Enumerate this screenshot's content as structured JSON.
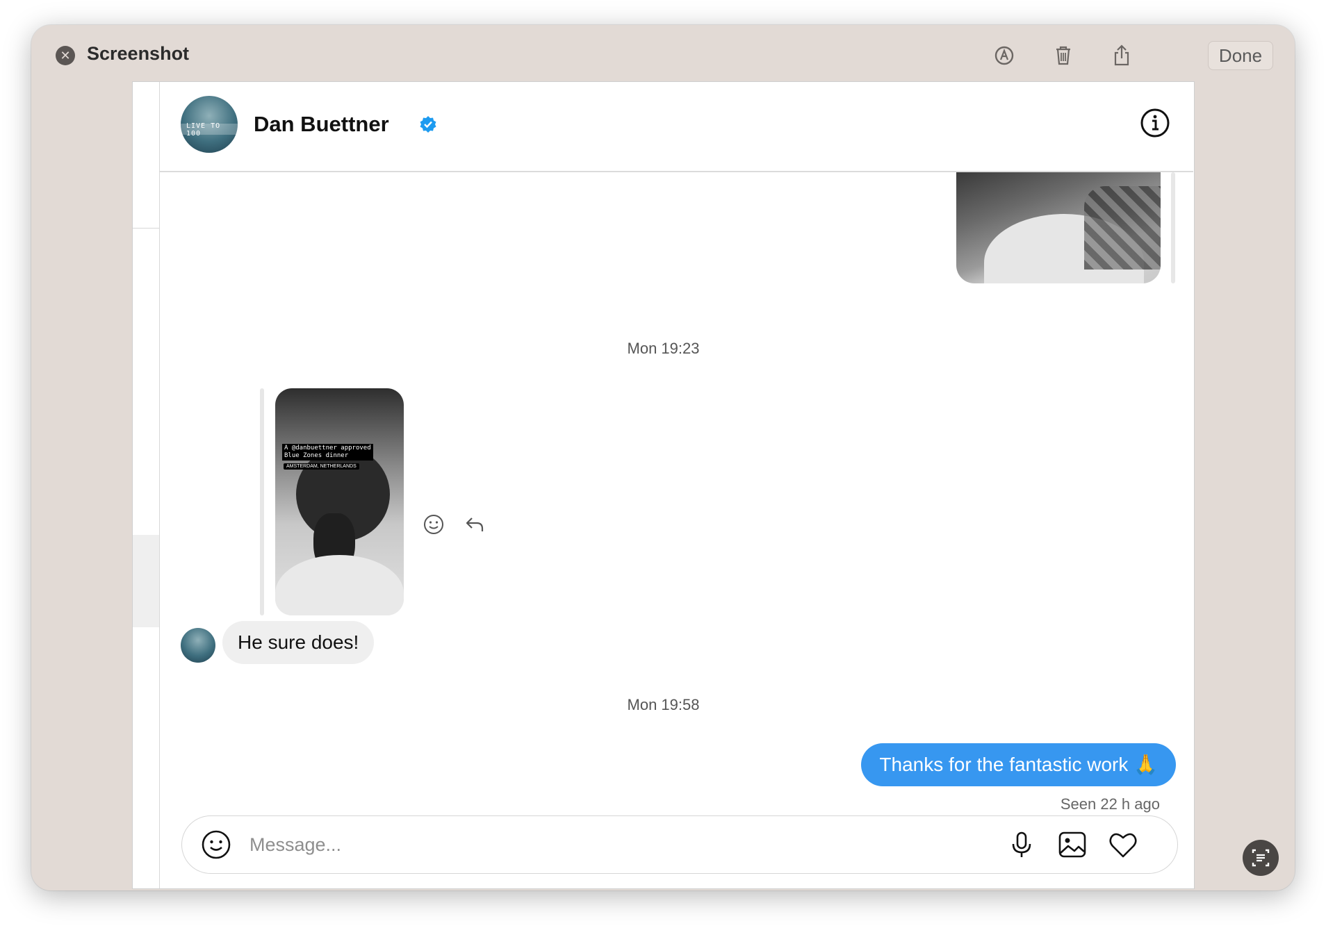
{
  "window": {
    "title": "Screenshot",
    "done_label": "Done"
  },
  "chat": {
    "contact_name": "Dan Buettner",
    "timestamps": [
      "Mon 19:23",
      "Mon 19:58"
    ],
    "story_caption_line1": "A @danbuettner approved",
    "story_caption_line2": "Blue Zones dinner",
    "story_location": "AMSTERDAM, NETHERLANDS",
    "avatar_text": "LIVE TO 100",
    "incoming_message": "He sure does!",
    "outgoing_message": "Thanks for the fantastic work 🙏",
    "seen_status": "Seen 22 h ago"
  },
  "composer": {
    "placeholder": "Message..."
  },
  "colors": {
    "accent": "#3797f0",
    "verified": "#1d9bf0",
    "window_bg": "#e2dad5"
  },
  "icons": [
    "close-icon",
    "markup-icon",
    "trash-icon",
    "share-icon",
    "verified-icon",
    "info-icon",
    "emoji-reaction-icon",
    "reply-icon",
    "emoji-icon",
    "microphone-icon",
    "image-icon",
    "heart-icon",
    "live-text-icon"
  ]
}
